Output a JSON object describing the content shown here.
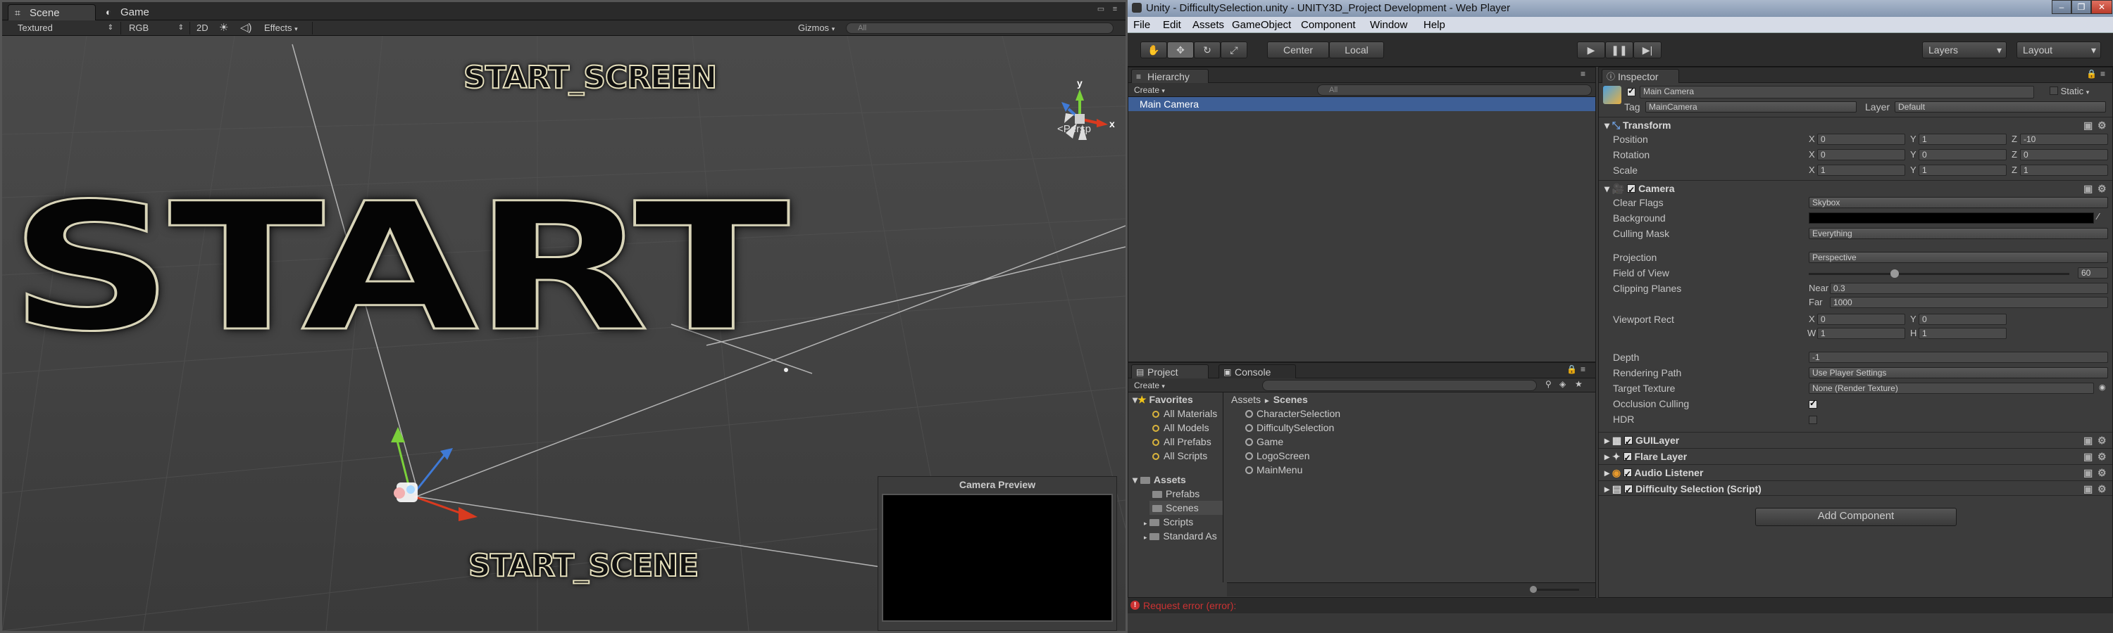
{
  "scene_tabs": [
    {
      "label": "Scene",
      "icon": "scene-icon"
    },
    {
      "label": "Game",
      "icon": "game-icon"
    }
  ],
  "scene_toolbar": {
    "shading": "Textured",
    "render_mode": "RGB",
    "mode_2d": "2D",
    "effects": "Effects",
    "gizmos": "Gizmos",
    "search_placeholder": "All"
  },
  "viewport": {
    "big_text": "START",
    "top_label": "START_SCREEN",
    "bottom_label": "START_SCENE",
    "persp": "Persp"
  },
  "camera_preview": {
    "title": "Camera Preview"
  },
  "window": {
    "title": "Unity - DifficultySelection.unity - UNITY3D_Project Development - Web Player"
  },
  "menu": [
    "File",
    "Edit",
    "Assets",
    "GameObject",
    "Component",
    "Window",
    "Help"
  ],
  "toolbar": {
    "center": "Center",
    "local": "Local",
    "layers": "Layers",
    "layout": "Layout"
  },
  "hierarchy": {
    "title": "Hierarchy",
    "create": "Create",
    "search": "All",
    "items": [
      "Main Camera"
    ]
  },
  "project": {
    "title": "Project",
    "console_title": "Console",
    "create": "Create",
    "favorites_label": "Favorites",
    "favorites": [
      "All Materials",
      "All Models",
      "All Prefabs",
      "All Scripts"
    ],
    "assets_label": "Assets",
    "assets": [
      "Prefabs",
      "Scenes",
      "Scripts",
      "Standard As"
    ],
    "breadcrumb_root": "Assets",
    "breadcrumb_sep": "►",
    "breadcrumb_leaf": "Scenes",
    "files": [
      "CharacterSelection",
      "DifficultySelection",
      "Game",
      "LogoScreen",
      "MainMenu"
    ]
  },
  "inspector": {
    "title": "Inspector",
    "object_name": "Main Camera",
    "static": "Static",
    "tag_label": "Tag",
    "tag": "MainCamera",
    "layer_label": "Layer",
    "layer": "Default",
    "transform": {
      "title": "Transform",
      "rows": [
        {
          "label": "Position",
          "x": "0",
          "y": "1",
          "z": "-10"
        },
        {
          "label": "Rotation",
          "x": "0",
          "y": "0",
          "z": "0"
        },
        {
          "label": "Scale",
          "x": "1",
          "y": "1",
          "z": "1"
        }
      ]
    },
    "camera": {
      "title": "Camera",
      "clear_flags_label": "Clear Flags",
      "clear_flags": "Skybox",
      "background_label": "Background",
      "culling_label": "Culling Mask",
      "culling": "Everything",
      "projection_label": "Projection",
      "projection": "Perspective",
      "fov_label": "Field of View",
      "fov": "60",
      "clipping_label": "Clipping Planes",
      "near_label": "Near",
      "near": "0.3",
      "far_label": "Far",
      "far": "1000",
      "viewport_label": "Viewport Rect",
      "vx": "0",
      "vy": "0",
      "vw": "1",
      "vh": "1",
      "depth_label": "Depth",
      "depth": "-1",
      "rendering_label": "Rendering Path",
      "rendering": "Use Player Settings",
      "target_label": "Target Texture",
      "target": "None (Render Texture)",
      "occlusion_label": "Occlusion Culling",
      "hdr_label": "HDR"
    },
    "components": [
      "GUILayer",
      "Flare Layer",
      "Audio Listener",
      "Difficulty Selection (Script)"
    ],
    "add_component": "Add Component"
  },
  "status": "Request error (error):",
  "colors": {
    "selection": "#3e5f96",
    "panel": "#3c3c3c",
    "error": "#cc3333"
  }
}
